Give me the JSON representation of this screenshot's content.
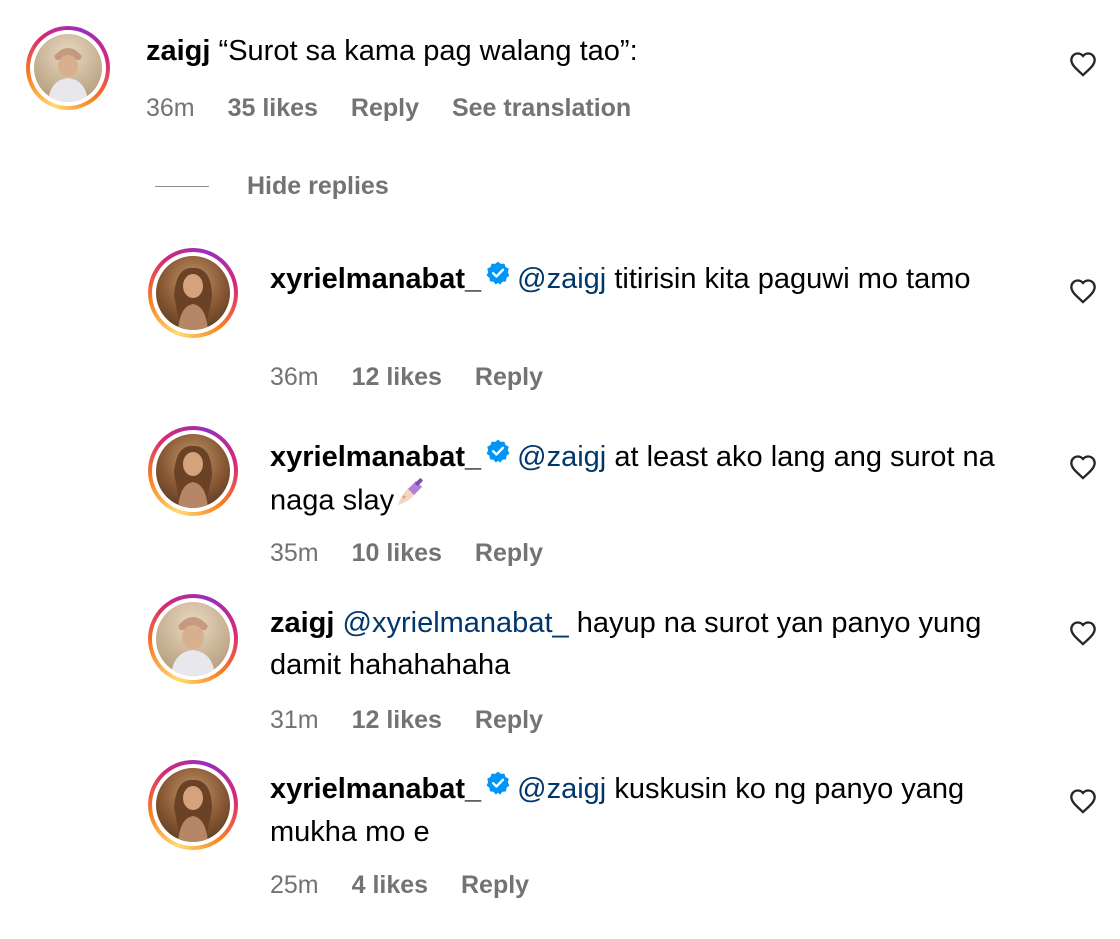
{
  "colors": {
    "meta_text": "#737373",
    "mention": "#00376b",
    "verified_badge": "#0095f6",
    "ring_gradient": [
      "#feda75",
      "#fa7e1e",
      "#d62976",
      "#962fbf"
    ]
  },
  "comments": [
    {
      "username": "zaigj",
      "verified": false,
      "mention": "",
      "text": "“Surot sa kama pag walang tao”:",
      "time": "36m",
      "likes": "35 likes",
      "reply": "Reply",
      "translation": "See translation",
      "avatar": "zaigj-avatar",
      "heart_icon": "heart-outline-icon"
    },
    {
      "username": "xyrielmanabat_",
      "verified": true,
      "mention": "@zaigj",
      "text": "titirisin kita paguwi mo tamo",
      "time": "36m",
      "likes": "12 likes",
      "reply": "Reply",
      "avatar": "xyrielmanabat-avatar",
      "heart_icon": "heart-outline-icon"
    },
    {
      "username": "xyrielmanabat_",
      "verified": true,
      "mention": "@zaigj",
      "text": "at least ako lang ang surot na naga slay",
      "emoji": "nail-polish-emoji",
      "time": "35m",
      "likes": "10 likes",
      "reply": "Reply",
      "avatar": "xyrielmanabat-avatar",
      "heart_icon": "heart-outline-icon"
    },
    {
      "username": "zaigj",
      "verified": false,
      "mention": "@xyrielmanabat_",
      "text": "hayup na surot yan panyo yung damit hahahahaha",
      "time": "31m",
      "likes": "12 likes",
      "reply": "Reply",
      "avatar": "zaigj-avatar",
      "heart_icon": "heart-outline-icon"
    },
    {
      "username": "xyrielmanabat_",
      "verified": true,
      "mention": "@zaigj",
      "text": "kuskusin ko ng panyo yang mukha mo e",
      "time": "25m",
      "likes": "4 likes",
      "reply": "Reply",
      "avatar": "xyrielmanabat-avatar",
      "heart_icon": "heart-outline-icon"
    }
  ],
  "hide_replies_label": "Hide replies"
}
